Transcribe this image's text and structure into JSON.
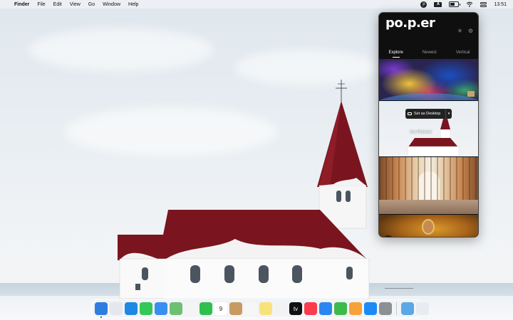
{
  "menubar": {
    "app_name": "Finder",
    "menus": [
      "File",
      "Edit",
      "View",
      "Go",
      "Window",
      "Help"
    ],
    "input_source": "A",
    "clock": "13:51"
  },
  "popper": {
    "logo": "po.p.er",
    "tabs": [
      {
        "label": "Explore",
        "active": true
      },
      {
        "label": "Newest",
        "active": false
      },
      {
        "label": "Vertical",
        "active": false
      }
    ],
    "set_desktop_label": "Set as Desktop",
    "credit": "Jon Flobrant",
    "accent": "#ffffff"
  },
  "dock": {
    "apps": [
      {
        "name": "finder",
        "color": "#2f7de1",
        "glyph": "",
        "running": true
      },
      {
        "name": "launchpad",
        "color": "#e4e7ec",
        "glyph": "",
        "running": false
      },
      {
        "name": "safari",
        "color": "#1e88e5",
        "glyph": "",
        "running": false
      },
      {
        "name": "messages",
        "color": "#34c759",
        "glyph": "",
        "running": false
      },
      {
        "name": "mail",
        "color": "#3a8ef0",
        "glyph": "",
        "running": false
      },
      {
        "name": "maps",
        "color": "#6fbf73",
        "glyph": "",
        "running": false
      },
      {
        "name": "photos",
        "color": "#f4f4f4",
        "glyph": "",
        "running": false
      },
      {
        "name": "facetime",
        "color": "#2fbf4f",
        "glyph": "",
        "running": false
      },
      {
        "name": "calendar",
        "color": "#ffffff",
        "glyph": "9",
        "running": false
      },
      {
        "name": "contacts",
        "color": "#c79a62",
        "glyph": "",
        "running": false
      },
      {
        "name": "reminders",
        "color": "#f6f6f6",
        "glyph": "",
        "running": false
      },
      {
        "name": "notes",
        "color": "#f8e27a",
        "glyph": "",
        "running": false
      },
      {
        "name": "freeform",
        "color": "#f2f2f2",
        "glyph": "",
        "running": false
      },
      {
        "name": "tv",
        "color": "#111111",
        "glyph": "tv",
        "running": false
      },
      {
        "name": "music",
        "color": "#fa3c4c",
        "glyph": "",
        "running": false
      },
      {
        "name": "keynote",
        "color": "#2c86f0",
        "glyph": "",
        "running": false
      },
      {
        "name": "numbers",
        "color": "#3dbb4a",
        "glyph": "",
        "running": false
      },
      {
        "name": "pages",
        "color": "#f7a13a",
        "glyph": "",
        "running": false
      },
      {
        "name": "app-store",
        "color": "#1c8bf5",
        "glyph": "",
        "running": false
      },
      {
        "name": "system-settings",
        "color": "#8c8f94",
        "glyph": "",
        "running": false
      }
    ],
    "extras": [
      {
        "name": "downloads-folder",
        "color": "#5aa8e6"
      },
      {
        "name": "trash",
        "color": "#e8ebef"
      }
    ]
  }
}
